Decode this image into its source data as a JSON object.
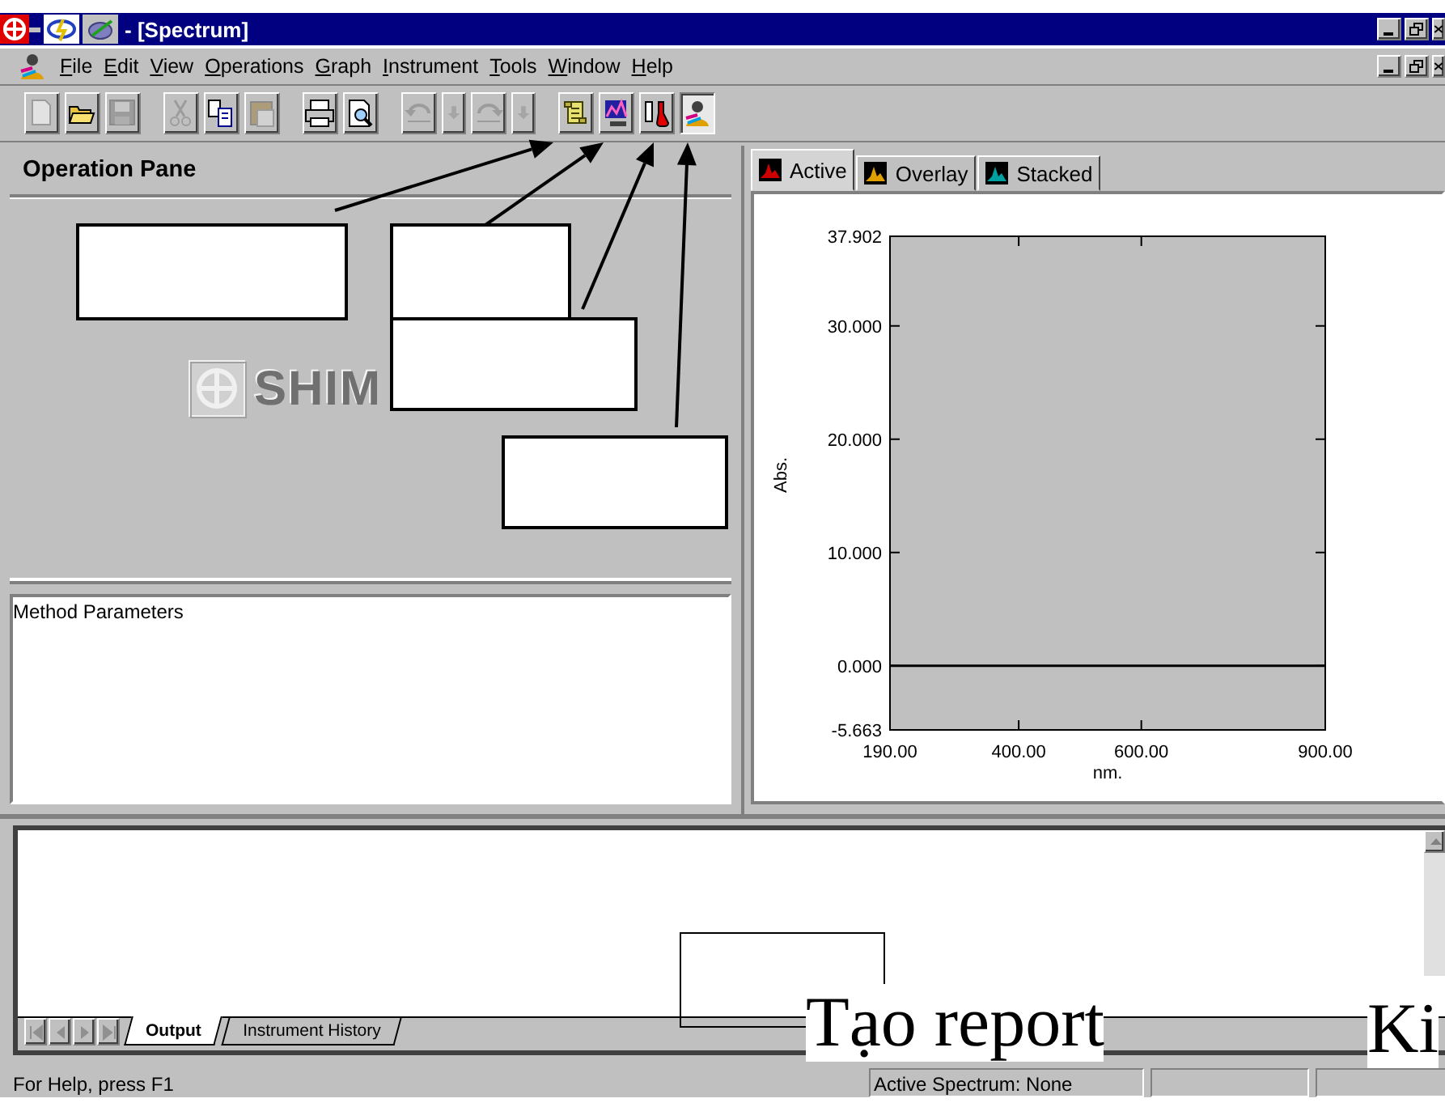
{
  "window": {
    "title": "- [Spectrum]"
  },
  "menu": [
    "File",
    "Edit",
    "View",
    "Operations",
    "Graph",
    "Instrument",
    "Tools",
    "Window",
    "Help"
  ],
  "toolbar": [
    {
      "kind": "new",
      "disabled": true,
      "pressed": false
    },
    {
      "kind": "open",
      "disabled": false,
      "pressed": false
    },
    {
      "kind": "save",
      "disabled": true,
      "pressed": false
    },
    {
      "kind": "separator"
    },
    {
      "kind": "cut",
      "disabled": true,
      "pressed": false
    },
    {
      "kind": "copy",
      "disabled": false,
      "pressed": false
    },
    {
      "kind": "paste",
      "disabled": true,
      "pressed": false
    },
    {
      "kind": "separator"
    },
    {
      "kind": "print",
      "disabled": false,
      "pressed": false
    },
    {
      "kind": "preview",
      "disabled": false,
      "pressed": false
    },
    {
      "kind": "separator"
    },
    {
      "kind": "undo",
      "disabled": true,
      "pressed": false
    },
    {
      "kind": "dropdown",
      "disabled": true,
      "pressed": false
    },
    {
      "kind": "redo",
      "disabled": true,
      "pressed": false
    },
    {
      "kind": "dropdown",
      "disabled": true,
      "pressed": false
    },
    {
      "kind": "separator"
    },
    {
      "kind": "report",
      "disabled": false,
      "pressed": false
    },
    {
      "kind": "spectrum",
      "disabled": false,
      "pressed": false
    },
    {
      "kind": "instrument",
      "disabled": false,
      "pressed": false
    },
    {
      "kind": "user",
      "disabled": false,
      "pressed": true
    }
  ],
  "operation_pane": {
    "title": "Operation Pane",
    "logo_text": "SHIM"
  },
  "method_pane": {
    "title": "Method Parameters"
  },
  "spectrum_tabs": [
    {
      "label": "Active",
      "selected": true,
      "color": "#cc0000"
    },
    {
      "label": "Overlay",
      "selected": false,
      "color": "#e0a000"
    },
    {
      "label": "Stacked",
      "selected": false,
      "color": "#00a0a0"
    }
  ],
  "chart": {
    "chart_data": {
      "type": "line",
      "xlabel": "nm.",
      "ylabel": "Abs.",
      "xlim": [
        190,
        900
      ],
      "ylim": [
        -5.663,
        37.902
      ],
      "xticks": [
        {
          "value": 190,
          "label": "190.00"
        },
        {
          "value": 400,
          "label": "400.00"
        },
        {
          "value": 600,
          "label": "600.00"
        },
        {
          "value": 900,
          "label": "900.00"
        }
      ],
      "yticks": [
        {
          "value": 37.902,
          "label": "37.902"
        },
        {
          "value": 30,
          "label": "30.000"
        },
        {
          "value": 20,
          "label": "20.000"
        },
        {
          "value": 10,
          "label": "10.000"
        },
        {
          "value": 0,
          "label": "0.000"
        },
        {
          "value": -5.663,
          "label": "-5.663"
        }
      ]
    }
  },
  "output_pane": {
    "tabs": [
      {
        "label": "Output",
        "selected": true
      },
      {
        "label": "Instrument History",
        "selected": false
      }
    ]
  },
  "status_bar": {
    "help": "For Help, press F1",
    "active_spectrum": "Active Spectrum: None"
  },
  "annotations": [
    "Tạo report",
    "Ki"
  ]
}
